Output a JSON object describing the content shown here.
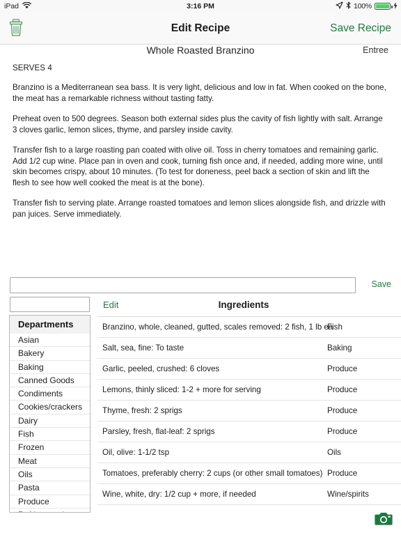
{
  "statusbar": {
    "device": "iPad",
    "wifi_icon": "wifi-icon",
    "time": "3:16 PM",
    "location_icon": "location-arrow-icon",
    "bluetooth_icon": "bluetooth-icon",
    "battery_pct": "100%",
    "charging_icon": "lightning-bolt-icon"
  },
  "navbar": {
    "trash_icon": "trash-icon",
    "title": "Edit Recipe",
    "save_label": "Save Recipe"
  },
  "recipe": {
    "title": "Whole Roasted Branzino",
    "category": "Entree",
    "serves": "SERVES 4",
    "paragraphs": [
      "Branzino is a Mediterranean sea bass. It is very light, delicious and low in fat. When cooked on the bone, the meat has a remarkable richness without tasting fatty.",
      "Preheat oven to 500 degrees. Season both external sides plus the cavity of fish lightly with salt. Arrange 3 cloves garlic, lemon slices, thyme, and parsley inside cavity.",
      "Transfer fish to a large roasting pan coated with olive oil. Toss in cherry tomatoes and remaining garlic. Add 1/2 cup wine. Place pan in oven and cook, turning fish once and, if needed, adding more wine, until skin becomes crispy, about 10 minutes. (To test for doneness, peel back a section of skin and lift the flesh to see how well cooked the meat is at the bone).",
      "Transfer fish to serving plate. Arrange roasted tomatoes and lemon slices alongside fish, and drizzle with pan juices. Serve immediately."
    ]
  },
  "add_row": {
    "input_value": "",
    "input_placeholder": "",
    "save_label": "Save"
  },
  "filter": {
    "input_value": "",
    "input_placeholder": ""
  },
  "table_header": {
    "edit_label": "Edit",
    "ingredients_label": "Ingredients"
  },
  "departments": {
    "header": "Departments",
    "items": [
      "Asian",
      "Bakery",
      "Baking",
      "Canned Goods",
      "Condiments",
      "Cookies/crackers",
      "Dairy",
      "Fish",
      "Frozen",
      "Meat",
      "Oils",
      "Pasta",
      "Produce",
      "Refrigerated"
    ]
  },
  "ingredients": [
    {
      "name": "Branzino, whole, cleaned, gutted, scales removed: 2 fish, 1 lb ea",
      "category": "Fish"
    },
    {
      "name": "Salt, sea, fine: To taste",
      "category": "Baking"
    },
    {
      "name": "Garlic, peeled, crushed: 6 cloves",
      "category": "Produce"
    },
    {
      "name": "Lemons, thinly sliced: 1-2 + more for serving",
      "category": "Produce"
    },
    {
      "name": "Thyme, fresh: 2 sprigs",
      "category": "Produce"
    },
    {
      "name": "Parsley, fresh, flat-leaf: 2 sprigs",
      "category": "Produce"
    },
    {
      "name": "Oil, olive: 1-1/2 tsp",
      "category": "Oils"
    },
    {
      "name": "Tomatoes, preferably cherry: 2 cups (or other small tomatoes)",
      "category": "Produce"
    },
    {
      "name": "Wine, white, dry: 1/2 cup + more, if needed",
      "category": "Wine/spirits"
    }
  ],
  "camera": {
    "icon": "camera-icon"
  },
  "colors": {
    "accent_green": "#247a3d",
    "battery_green": "#4cd463",
    "text": "#1d1d1d",
    "border": "#d9d9d9"
  }
}
